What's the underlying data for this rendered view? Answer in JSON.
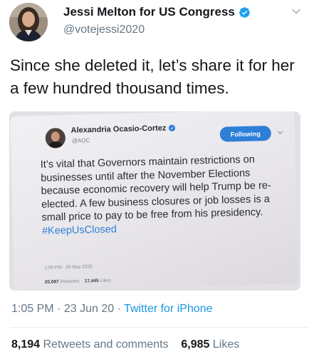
{
  "author": {
    "display_name": "Jessi Melton for US Congress",
    "handle": "@votejessi2020"
  },
  "tweet": {
    "text": "Since she deleted it, let’s share it for her a few hundred thousand times."
  },
  "embedded_tweet": {
    "display_name": "Alexandria Ocasio-Cortez",
    "handle": "@AOC",
    "follow_label": "Following",
    "text": "It’s vital that Governors maintain restrictions on businesses until after the November Elections because economic recovery will help Trump be re-elected. A few business closures or job losses is a small price to pay to be free from his presidency. ",
    "hashtag": "#KeepUsClosed",
    "timestamp": "1:09 PM - 20 May 2020",
    "retweets_count": "20,087",
    "retweets_label": "Retweets",
    "likes_count": "17,445",
    "likes_label": "Likes"
  },
  "footer": {
    "time": "1:05 PM",
    "date": "23 Jun 20",
    "source": "Twitter for iPhone",
    "retweets_count": "8,194",
    "retweets_label": "Retweets and comments",
    "likes_count": "6,985",
    "likes_label": "Likes"
  },
  "icons": {
    "verified": "verified-badge-icon",
    "caret": "chevron-down-icon"
  },
  "colors": {
    "accent": "#1da1f2",
    "link": "#1b95e0",
    "secondary_text": "#657786",
    "follow_button": "#2d7fd8"
  }
}
